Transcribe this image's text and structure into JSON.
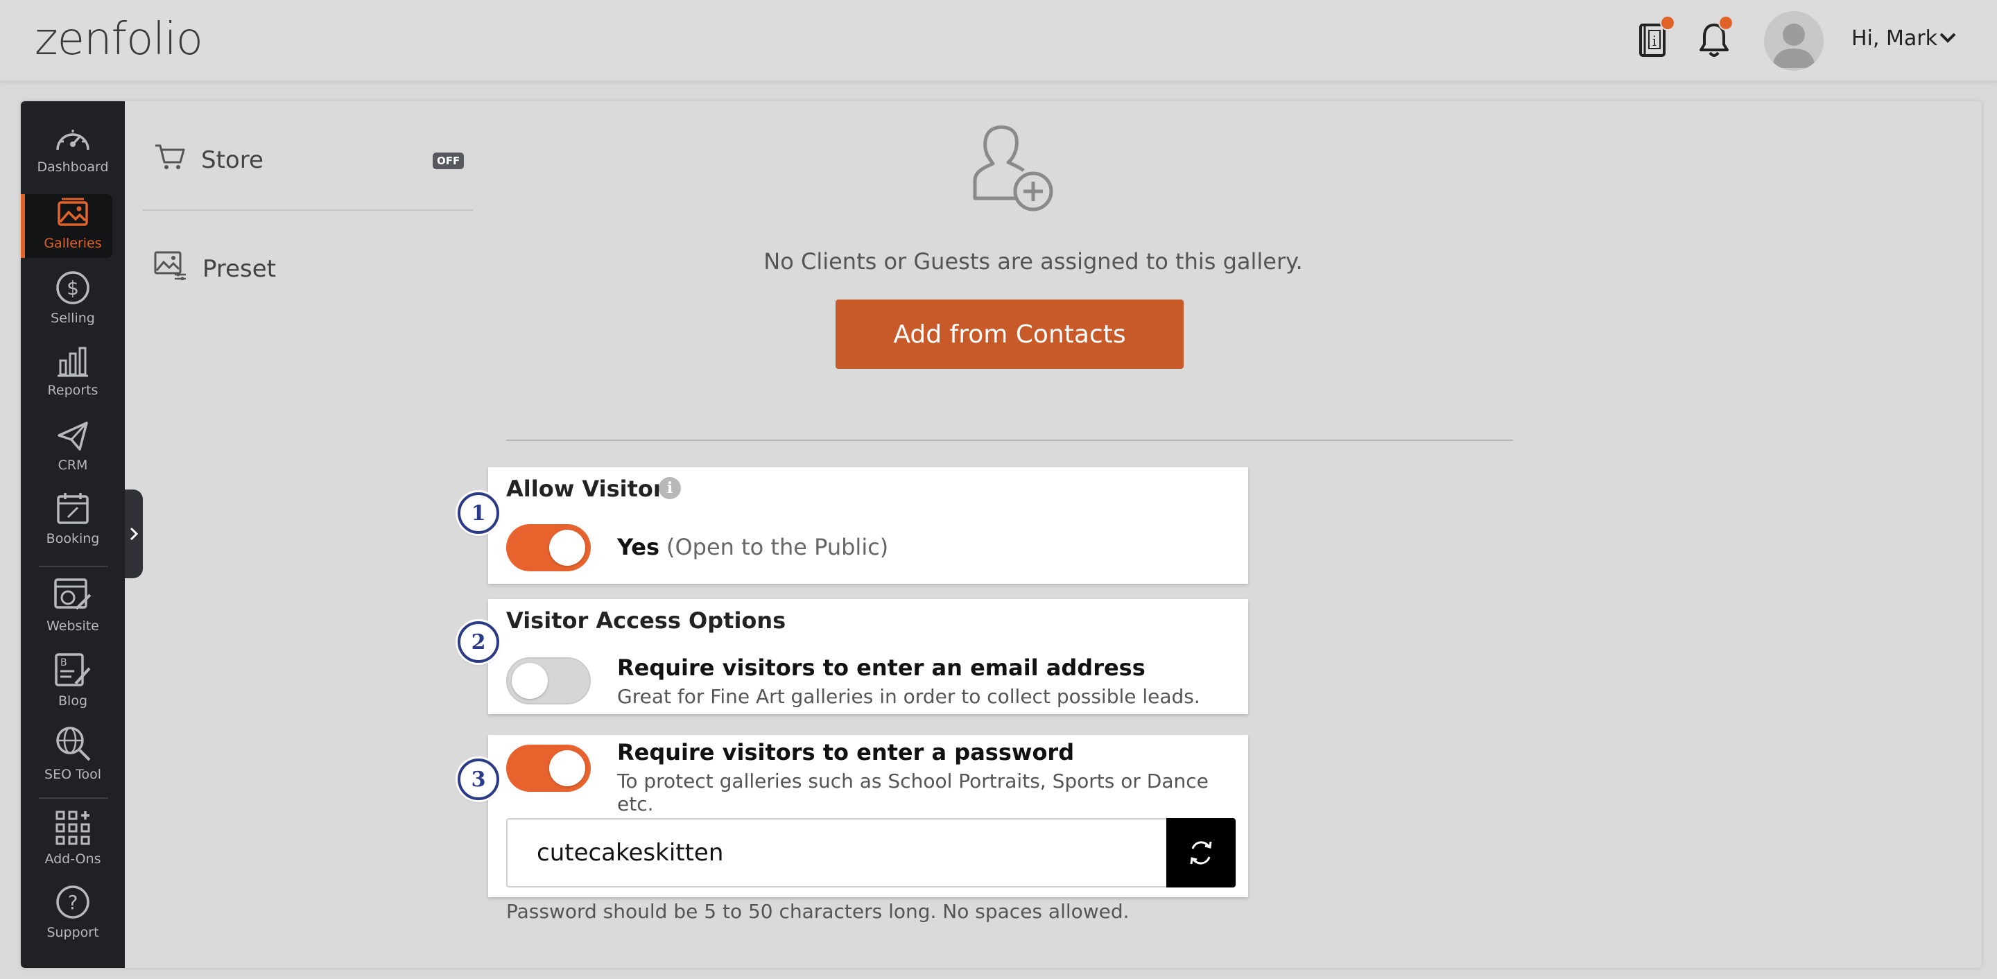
{
  "header": {
    "logo": "zenfolio",
    "greeting": "Hi, Mark",
    "icons": [
      "guide-book-icon",
      "bell-icon",
      "avatar-icon",
      "chevron-down-icon"
    ],
    "notification_color": "#e0632a"
  },
  "sidebar": {
    "items": [
      {
        "label": "Dashboard",
        "icon": "speedometer-icon",
        "active": false
      },
      {
        "label": "Galleries",
        "icon": "image-icon",
        "active": true
      },
      {
        "label": "Selling",
        "icon": "dollar-circle-icon",
        "active": false
      },
      {
        "label": "Reports",
        "icon": "bar-chart-icon",
        "active": false
      },
      {
        "label": "CRM",
        "icon": "paper-plane-icon",
        "active": false
      },
      {
        "label": "Booking",
        "icon": "calendar-icon",
        "active": false
      },
      {
        "label": "Website",
        "icon": "website-edit-icon",
        "active": false
      },
      {
        "label": "Blog",
        "icon": "blog-edit-icon",
        "active": false
      },
      {
        "label": "SEO Tool",
        "icon": "globe-search-icon",
        "active": false
      },
      {
        "label": "Add-Ons",
        "icon": "grid-plus-icon",
        "active": false
      },
      {
        "label": "Support",
        "icon": "question-circle-icon",
        "active": false
      }
    ],
    "accent": "#e0632a"
  },
  "submenu": {
    "store_label": "Store",
    "store_badge": "OFF",
    "preset_label": "Preset"
  },
  "clients": {
    "empty_message": "No Clients or Guests are assigned to this gallery.",
    "add_button": "Add from Contacts"
  },
  "visitors": {
    "title": "Allow Visitors",
    "step": "1",
    "enabled": true,
    "yes_label": "Yes",
    "yes_note": "(Open to the Public)"
  },
  "access_options": {
    "title": "Visitor Access Options",
    "email": {
      "step": "2",
      "enabled": false,
      "title": "Require visitors to enter an email address",
      "subtitle": "Great for Fine Art galleries in order to collect possible leads."
    },
    "password": {
      "step": "3",
      "enabled": true,
      "title": "Require visitors to enter a password",
      "subtitle": "To protect galleries such as School Portraits, Sports or Dance etc.",
      "value": "cutecakeskitten",
      "hint": "Password should be 5 to 50 characters long. No spaces allowed."
    }
  }
}
